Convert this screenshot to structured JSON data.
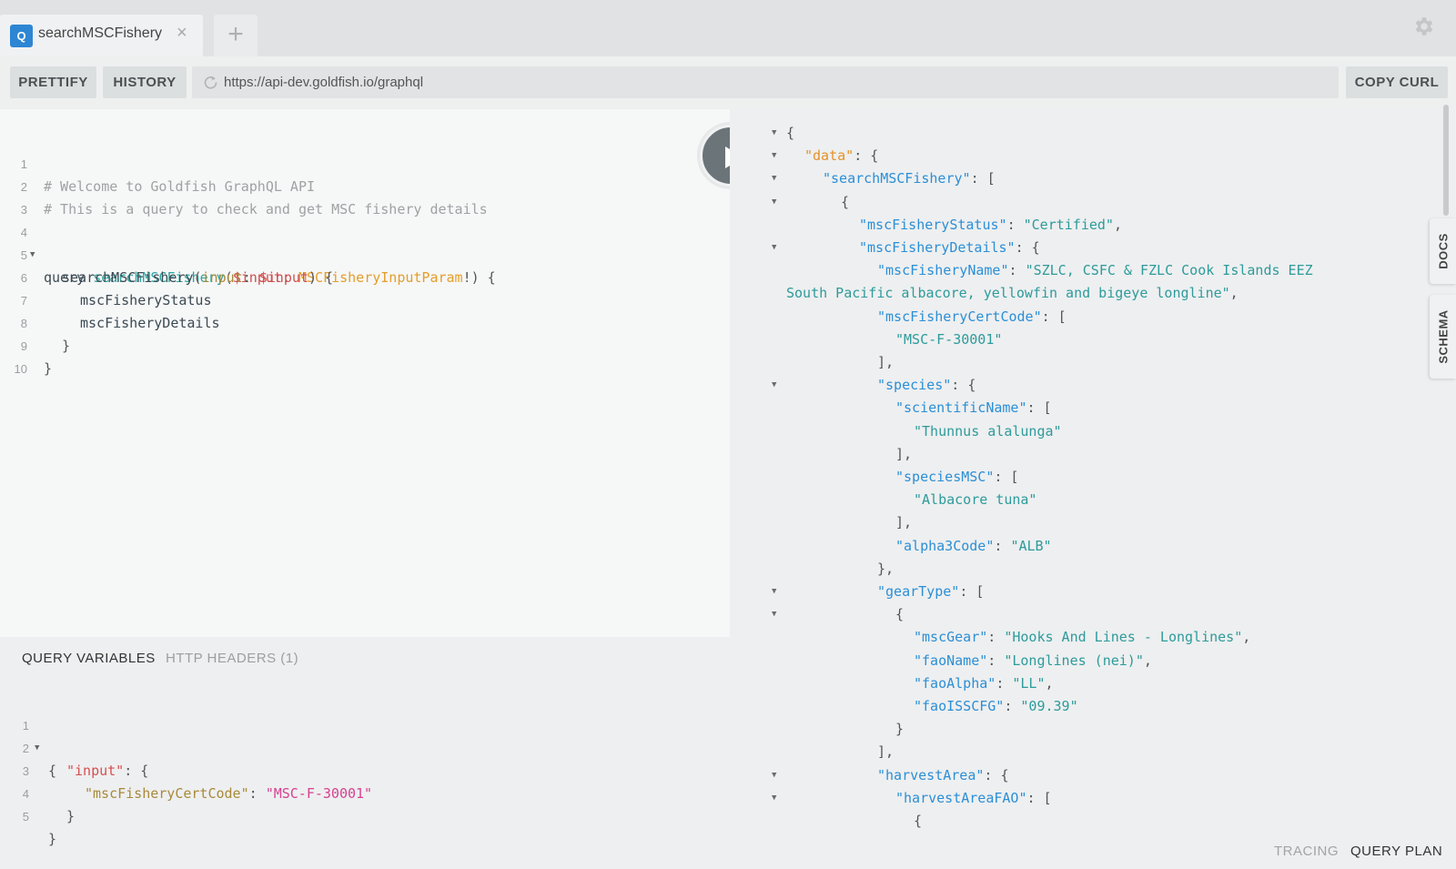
{
  "tab": {
    "badge": "Q",
    "title": "searchMSCFishery",
    "close": "×",
    "add": "+"
  },
  "toolbar": {
    "prettify": "PRETTIFY",
    "history": "HISTORY",
    "url": "https://api-dev.goldfish.io/graphql",
    "copy_curl": "COPY CURL"
  },
  "editor": {
    "line_numbers": [
      "1",
      "2",
      "3",
      "4",
      "5",
      "6",
      "7",
      "8",
      "9",
      "10"
    ],
    "l1": "# Welcome to Goldfish GraphQL API",
    "l2": "# This is a query to check and get MSC fishery details",
    "l4_kw": "query",
    "l4_name": "searchMSCFishery",
    "l4_open": "(",
    "l4_var": "$input",
    "l4_colon": ": ",
    "l4_type": "MSCFisheryInputParam",
    "l4_close": "!) {",
    "l5_field": "searchMSCFishery",
    "l5_open": "(",
    "l5_arg": "input",
    "l5_colon": ": ",
    "l5_var": "$input",
    "l5_close": ") {",
    "l6": "mscFisheryStatus",
    "l7": "mscFisheryDetails",
    "l8": "}",
    "l9": "}"
  },
  "variables": {
    "tab_query_vars": "QUERY VARIABLES",
    "tab_http_headers": "HTTP HEADERS (1)",
    "line_numbers": [
      "1",
      "2",
      "3",
      "4",
      "5"
    ],
    "l1": "{",
    "l2_key": "\"input\"",
    "l2_rest": ": {",
    "l3_key": "\"mscFisheryCertCode\"",
    "l3_colon": ": ",
    "l3_val": "\"MSC-F-30001\"",
    "l4": "}",
    "l5": "}"
  },
  "result": {
    "lines": [
      {
        "fold": true,
        "indent": 0,
        "parts": [
          {
            "t": "{",
            "c": "jp"
          }
        ]
      },
      {
        "fold": true,
        "indent": 1,
        "parts": [
          {
            "t": "\"data\"",
            "c": "jko"
          },
          {
            "t": ": {",
            "c": "jp"
          }
        ]
      },
      {
        "fold": true,
        "indent": 2,
        "parts": [
          {
            "t": "\"searchMSCFishery\"",
            "c": "jk"
          },
          {
            "t": ": [",
            "c": "jp"
          }
        ]
      },
      {
        "fold": true,
        "indent": 3,
        "parts": [
          {
            "t": "{",
            "c": "jp"
          }
        ]
      },
      {
        "fold": false,
        "indent": 4,
        "parts": [
          {
            "t": "\"mscFisheryStatus\"",
            "c": "jk"
          },
          {
            "t": ": ",
            "c": "jp"
          },
          {
            "t": "\"Certified\"",
            "c": "js"
          },
          {
            "t": ",",
            "c": "jp"
          }
        ]
      },
      {
        "fold": true,
        "indent": 4,
        "parts": [
          {
            "t": "\"mscFisheryDetails\"",
            "c": "jk"
          },
          {
            "t": ": {",
            "c": "jp"
          }
        ]
      },
      {
        "fold": false,
        "indent": 5,
        "parts": [
          {
            "t": "\"mscFisheryName\"",
            "c": "jk"
          },
          {
            "t": ": ",
            "c": "jp"
          },
          {
            "t": "\"SZLC, CSFC & FZLC Cook Islands EEZ",
            "c": "js"
          }
        ]
      },
      {
        "fold": false,
        "indent": 0,
        "parts": [
          {
            "t": "South Pacific albacore, yellowfin and bigeye longline\"",
            "c": "js"
          },
          {
            "t": ",",
            "c": "jp"
          }
        ]
      },
      {
        "fold": false,
        "indent": 5,
        "parts": [
          {
            "t": "\"mscFisheryCertCode\"",
            "c": "jk"
          },
          {
            "t": ": [",
            "c": "jp"
          }
        ]
      },
      {
        "fold": false,
        "indent": 6,
        "parts": [
          {
            "t": "\"MSC-F-30001\"",
            "c": "js"
          }
        ]
      },
      {
        "fold": false,
        "indent": 5,
        "parts": [
          {
            "t": "],",
            "c": "jp"
          }
        ]
      },
      {
        "fold": true,
        "indent": 5,
        "parts": [
          {
            "t": "\"species\"",
            "c": "jk"
          },
          {
            "t": ": {",
            "c": "jp"
          }
        ]
      },
      {
        "fold": false,
        "indent": 6,
        "parts": [
          {
            "t": "\"scientificName\"",
            "c": "jk"
          },
          {
            "t": ": [",
            "c": "jp"
          }
        ]
      },
      {
        "fold": false,
        "indent": 7,
        "parts": [
          {
            "t": "\"Thunnus alalunga\"",
            "c": "js"
          }
        ]
      },
      {
        "fold": false,
        "indent": 6,
        "parts": [
          {
            "t": "],",
            "c": "jp"
          }
        ]
      },
      {
        "fold": false,
        "indent": 6,
        "parts": [
          {
            "t": "\"speciesMSC\"",
            "c": "jk"
          },
          {
            "t": ": [",
            "c": "jp"
          }
        ]
      },
      {
        "fold": false,
        "indent": 7,
        "parts": [
          {
            "t": "\"Albacore tuna\"",
            "c": "js"
          }
        ]
      },
      {
        "fold": false,
        "indent": 6,
        "parts": [
          {
            "t": "],",
            "c": "jp"
          }
        ]
      },
      {
        "fold": false,
        "indent": 6,
        "parts": [
          {
            "t": "\"alpha3Code\"",
            "c": "jk"
          },
          {
            "t": ": ",
            "c": "jp"
          },
          {
            "t": "\"ALB\"",
            "c": "js"
          }
        ]
      },
      {
        "fold": false,
        "indent": 5,
        "parts": [
          {
            "t": "},",
            "c": "jp"
          }
        ]
      },
      {
        "fold": true,
        "indent": 5,
        "parts": [
          {
            "t": "\"gearType\"",
            "c": "jk"
          },
          {
            "t": ": [",
            "c": "jp"
          }
        ]
      },
      {
        "fold": true,
        "indent": 6,
        "parts": [
          {
            "t": "{",
            "c": "jp"
          }
        ]
      },
      {
        "fold": false,
        "indent": 7,
        "parts": [
          {
            "t": "\"mscGear\"",
            "c": "jk"
          },
          {
            "t": ": ",
            "c": "jp"
          },
          {
            "t": "\"Hooks And Lines - Longlines\"",
            "c": "js"
          },
          {
            "t": ",",
            "c": "jp"
          }
        ]
      },
      {
        "fold": false,
        "indent": 7,
        "parts": [
          {
            "t": "\"faoName\"",
            "c": "jk"
          },
          {
            "t": ": ",
            "c": "jp"
          },
          {
            "t": "\"Longlines (nei)\"",
            "c": "js"
          },
          {
            "t": ",",
            "c": "jp"
          }
        ]
      },
      {
        "fold": false,
        "indent": 7,
        "parts": [
          {
            "t": "\"faoAlpha\"",
            "c": "jk"
          },
          {
            "t": ": ",
            "c": "jp"
          },
          {
            "t": "\"LL\"",
            "c": "js"
          },
          {
            "t": ",",
            "c": "jp"
          }
        ]
      },
      {
        "fold": false,
        "indent": 7,
        "parts": [
          {
            "t": "\"faoISSCFG\"",
            "c": "jk"
          },
          {
            "t": ": ",
            "c": "jp"
          },
          {
            "t": "\"09.39\"",
            "c": "js"
          }
        ]
      },
      {
        "fold": false,
        "indent": 6,
        "parts": [
          {
            "t": "}",
            "c": "jp"
          }
        ]
      },
      {
        "fold": false,
        "indent": 5,
        "parts": [
          {
            "t": "],",
            "c": "jp"
          }
        ]
      },
      {
        "fold": true,
        "indent": 5,
        "parts": [
          {
            "t": "\"harvestArea\"",
            "c": "jk"
          },
          {
            "t": ": {",
            "c": "jp"
          }
        ]
      },
      {
        "fold": true,
        "indent": 6,
        "parts": [
          {
            "t": "\"harvestAreaFAO\"",
            "c": "jk"
          },
          {
            "t": ": [",
            "c": "jp"
          }
        ]
      },
      {
        "fold": false,
        "indent": 7,
        "parts": [
          {
            "t": "{",
            "c": "jp"
          }
        ]
      }
    ]
  },
  "side_tabs": {
    "docs": "DOCS",
    "schema": "SCHEMA"
  },
  "footer": {
    "tracing": "TRACING",
    "query_plan": "QUERY PLAN"
  },
  "icons": {
    "settings": "gear-icon",
    "run": "play-icon",
    "reload": "reload-icon",
    "close": "close-icon",
    "add": "plus-icon"
  },
  "colors": {
    "tab_badge": "#2d86d3",
    "run_button": "#6b7479",
    "json_key": "#2b8fd6",
    "json_string": "#2d9b9b",
    "comment": "#9fa2a4"
  }
}
